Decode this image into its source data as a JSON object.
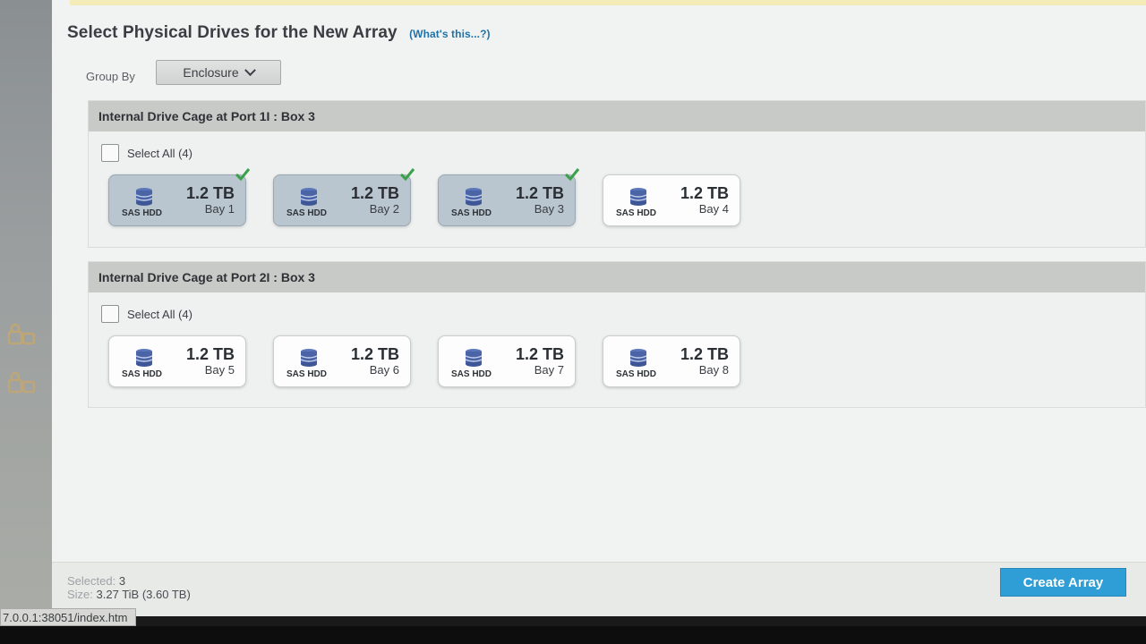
{
  "page": {
    "title": "Select Physical Drives for the New Array",
    "whats_this": "(What's this...?)"
  },
  "group_by": {
    "label": "Group By",
    "selected": "Enclosure"
  },
  "groups": [
    {
      "title": "Internal Drive Cage at Port 1I : Box 3",
      "select_all": "Select All (4)",
      "select_all_checked": false,
      "drives": [
        {
          "capacity": "1.2 TB",
          "type": "SAS HDD",
          "bay": "Bay 1",
          "selected": true
        },
        {
          "capacity": "1.2 TB",
          "type": "SAS HDD",
          "bay": "Bay 2",
          "selected": true
        },
        {
          "capacity": "1.2 TB",
          "type": "SAS HDD",
          "bay": "Bay 3",
          "selected": true
        },
        {
          "capacity": "1.2 TB",
          "type": "SAS HDD",
          "bay": "Bay 4",
          "selected": false
        }
      ]
    },
    {
      "title": "Internal Drive Cage at Port 2I : Box 3",
      "select_all": "Select All (4)",
      "select_all_checked": false,
      "drives": [
        {
          "capacity": "1.2 TB",
          "type": "SAS HDD",
          "bay": "Bay 5",
          "selected": false
        },
        {
          "capacity": "1.2 TB",
          "type": "SAS HDD",
          "bay": "Bay 6",
          "selected": false
        },
        {
          "capacity": "1.2 TB",
          "type": "SAS HDD",
          "bay": "Bay 7",
          "selected": false
        },
        {
          "capacity": "1.2 TB",
          "type": "SAS HDD",
          "bay": "Bay 8",
          "selected": false
        }
      ]
    }
  ],
  "footer": {
    "selected_label": "Selected:",
    "selected_value": "3",
    "size_label": "Size:",
    "size_value": "3.27 TiB (3.60 TB)",
    "create_button": "Create Array"
  },
  "status_bar": {
    "url": "7.0.0.1:38051/index.htm"
  },
  "colors": {
    "accent": "#2f9ed7",
    "link": "#1f72a8",
    "selected_drive": "#b9c5cf",
    "check": "#3aa04a"
  }
}
